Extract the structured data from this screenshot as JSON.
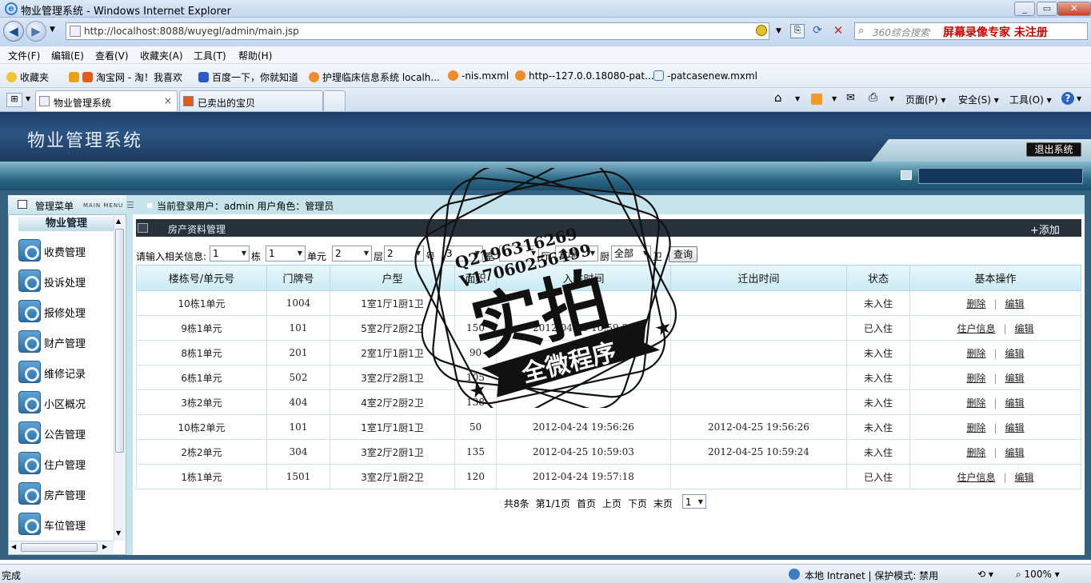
{
  "window": {
    "title": "物业管理系统 - Windows Internet Explorer",
    "min": "_",
    "max": "▭",
    "close": "✕"
  },
  "address": {
    "url": "http://localhost:8088/wuyegl/admin/main.jsp",
    "search_placeholder": "360综合搜索",
    "search_promo": "屏幕录像专家  未注册"
  },
  "menubar": [
    "文件(F)",
    "编辑(E)",
    "查看(V)",
    "收藏夹(A)",
    "工具(T)",
    "帮助(H)"
  ],
  "favorites": {
    "label": "收藏夹",
    "items": [
      "淘宝网 - 淘！我喜欢",
      "百度一下，你就知道",
      "护理临床信息系统 localh...",
      "-nis.mxml",
      "http--127.0.0.18080-pat...",
      "-patcasenew.mxml"
    ]
  },
  "tabs": [
    {
      "label": "物业管理系统",
      "close": "×"
    },
    {
      "label": "已卖出的宝贝"
    }
  ],
  "commandbar": {
    "page": "页面(P)",
    "safety": "安全(S)",
    "tools": "工具(O)"
  },
  "app": {
    "title": "物业管理系统",
    "logout": "退出系统"
  },
  "sidebar": {
    "header": "管理菜单",
    "header_sub": "MAIN MENU",
    "group": "物业管理",
    "items": [
      "收费管理",
      "投诉处理",
      "报修处理",
      "财产管理",
      "维修记录",
      "小区概况",
      "公告管理",
      "住户管理",
      "房产管理",
      "车位管理"
    ]
  },
  "userinfo": "当前登录用户：admin  用户角色：管理员",
  "section": {
    "title": "房产资料管理",
    "add": "+添加"
  },
  "filter": {
    "prompt": "请输入相关信息:",
    "building": "1",
    "building_unit": "栋",
    "unit": "1",
    "unit_unit": "单元",
    "floor": "2",
    "floor_unit": "层",
    "room": "2",
    "room_unit": "号",
    "f_shi": "3",
    "shi_unit": "室",
    "f_ting": "",
    "ting_unit": "厅",
    "f_chu": "全部",
    "chu_unit": "厨",
    "f_wei": "全部",
    "wei_unit": "卫",
    "query": "查询"
  },
  "table": {
    "headers": [
      "楼栋号/单元号",
      "门牌号",
      "户型",
      "面积",
      "入住时间",
      "迁出时间",
      "状态",
      "基本操作"
    ],
    "rows": [
      {
        "bu": "10栋1单元",
        "door": "1004",
        "type": "1室1厅1厨1卫",
        "area": "",
        "in": "",
        "out": "",
        "status": "未入住",
        "a1": "删除",
        "a2": "编辑"
      },
      {
        "bu": "9栋1单元",
        "door": "101",
        "type": "5室2厅2厨2卫",
        "area": "150",
        "in": "2012-04-25 10:59:24",
        "out": "",
        "status": "已入住",
        "a1": "住户信息",
        "a2": "编辑"
      },
      {
        "bu": "8栋1单元",
        "door": "201",
        "type": "2室1厅1厨1卫",
        "area": "90",
        "in": "",
        "out": "",
        "status": "未入住",
        "a1": "删除",
        "a2": "编辑"
      },
      {
        "bu": "6栋1单元",
        "door": "502",
        "type": "3室2厅2厨1卫",
        "area": "105",
        "in": "",
        "out": "",
        "status": "未入住",
        "a1": "删除",
        "a2": "编辑"
      },
      {
        "bu": "3栋2单元",
        "door": "404",
        "type": "4室2厅2厨2卫",
        "area": "138",
        "in": "",
        "out": "",
        "status": "未入住",
        "a1": "删除",
        "a2": "编辑"
      },
      {
        "bu": "10栋2单元",
        "door": "101",
        "type": "1室1厅1厨1卫",
        "area": "50",
        "in": "2012-04-24 19:56:26",
        "out": "2012-04-25 19:56:26",
        "status": "未入住",
        "a1": "删除",
        "a2": "编辑"
      },
      {
        "bu": "2栋2单元",
        "door": "304",
        "type": "3室2厅2厨1卫",
        "area": "135",
        "in": "2012-04-25 10:59:03",
        "out": "2012-04-25 10:59:24",
        "status": "未入住",
        "a1": "删除",
        "a2": "编辑"
      },
      {
        "bu": "1栋1单元",
        "door": "1501",
        "type": "3室2厅1厨2卫",
        "area": "120",
        "in": "2012-04-24 19:57:18",
        "out": "",
        "status": "已入住",
        "a1": "住户信息",
        "a2": "编辑"
      }
    ]
  },
  "pager": {
    "total": "共8条",
    "page": "第1/1页",
    "first": "首页",
    "prev": "上页",
    "next": "下页",
    "last": "末页",
    "current": "1"
  },
  "status": {
    "left": "完成",
    "zone": "本地 Intranet | 保护模式: 禁用",
    "zoom": "100%"
  },
  "watermark": {
    "qq": "Q2196316269",
    "vx": "V17060256499",
    "big": "实拍",
    "ribbon": "全微程序"
  }
}
